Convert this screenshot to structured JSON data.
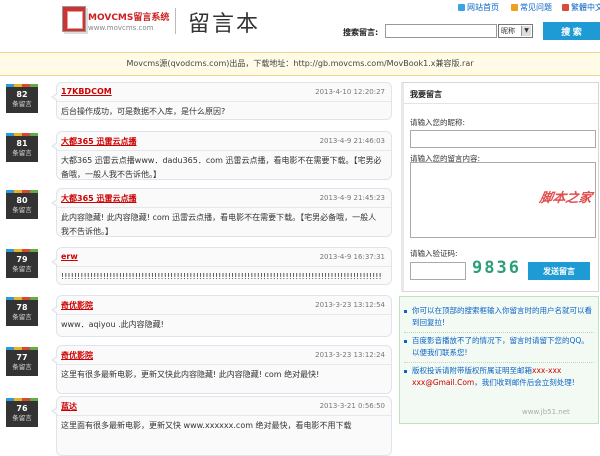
{
  "brand": {
    "name": "MOVCMS留言系统",
    "url": "www.movcms.com"
  },
  "page_title": "留言本",
  "top_links": [
    {
      "label": "网站首页",
      "color": "#3aa3e0"
    },
    {
      "label": "常见问题",
      "color": "#f0a020"
    },
    {
      "label": "繁體中文",
      "color": "#d84a3a"
    }
  ],
  "search": {
    "label": "搜索留言:",
    "value": "",
    "select_value": "昵称",
    "button": "搜 索"
  },
  "notice": "Movcms源(qvodcms.com)出品，下载地址：http://gb.movcms.com/MovBook1.x兼容版.rar",
  "badge_suffix": "条留言",
  "entries": [
    {
      "num": "82",
      "name": "17KBDCOM",
      "date": "2013-4-10 12:20:27",
      "body": "后台操作成功，可是数据不入库，是什么原因?"
    },
    {
      "num": "81",
      "name": "大都365 迅雷云点播",
      "date": "2013-4-9 21:46:03",
      "body": "大都365 迅雷云点播www．dadu365．com 迅雷云点播，看电影不在需要下载。【宅男必备哦，一般人我不告诉他。】"
    },
    {
      "num": "80",
      "name": "大都365 迅雷云点播",
      "date": "2013-4-9 21:45:23",
      "body": "此内容隐藏! 此内容隐藏! com 迅雷云点播，看电影不在需要下载。【宅男必备哦，一般人我不告诉他。】"
    },
    {
      "num": "79",
      "name": "erw",
      "date": "2013-4-9 16:37:31",
      "body": "!!!!!!!!!!!!!!!!!!!!!!!!!!!!!!!!!!!!!!!!!!!!!!!!!!!!!!!!!!!!!!!!!!!!!!!!!!!!!!!!!!!!!!!!!!!!!!!!!!!!!!!!!!!!!!!!!!"
    },
    {
      "num": "78",
      "name": "奇优影院",
      "date": "2013-3-23 13:12:54",
      "body": "www．aqiyou .此内容隐藏!"
    },
    {
      "num": "77",
      "name": "奇优影院",
      "date": "2013-3-23 13:12:24",
      "body": "这里有很多最新电影，更新又快此内容隐藏! 此内容隐藏! com 绝对最快!"
    },
    {
      "num": "76",
      "name": "蓝达",
      "date": "2013-3-21 0:56:50",
      "body": "这里面有很多最新电影，更新又快 www.xxxxxx.com 绝对最快，看电影不用下载"
    }
  ],
  "form": {
    "title": "我要留言",
    "nickname_label": "请输入您的昵称:",
    "content_label": "请输入您的留言内容:",
    "captcha_label": "请输入验证码:",
    "captcha": "9836",
    "submit": "发送留言"
  },
  "help": {
    "tip1": "你可以在顶部的搜索框输入你留言时的用户名就可以看到回复拉!",
    "tip2": "百度影音播放不了的情况下，留言时请留下您的QQ。以便我们联系您!",
    "tip3_pre": "版权投诉请附带版权所属证明至邮箱",
    "tip3_email": "xxx-xxx xxx@Gmail.Com",
    "tip3_post": "，我们收到邮件后会立刻处理!"
  },
  "watermark": {
    "text": "脚本之家",
    "url": "www.jb51.net"
  }
}
